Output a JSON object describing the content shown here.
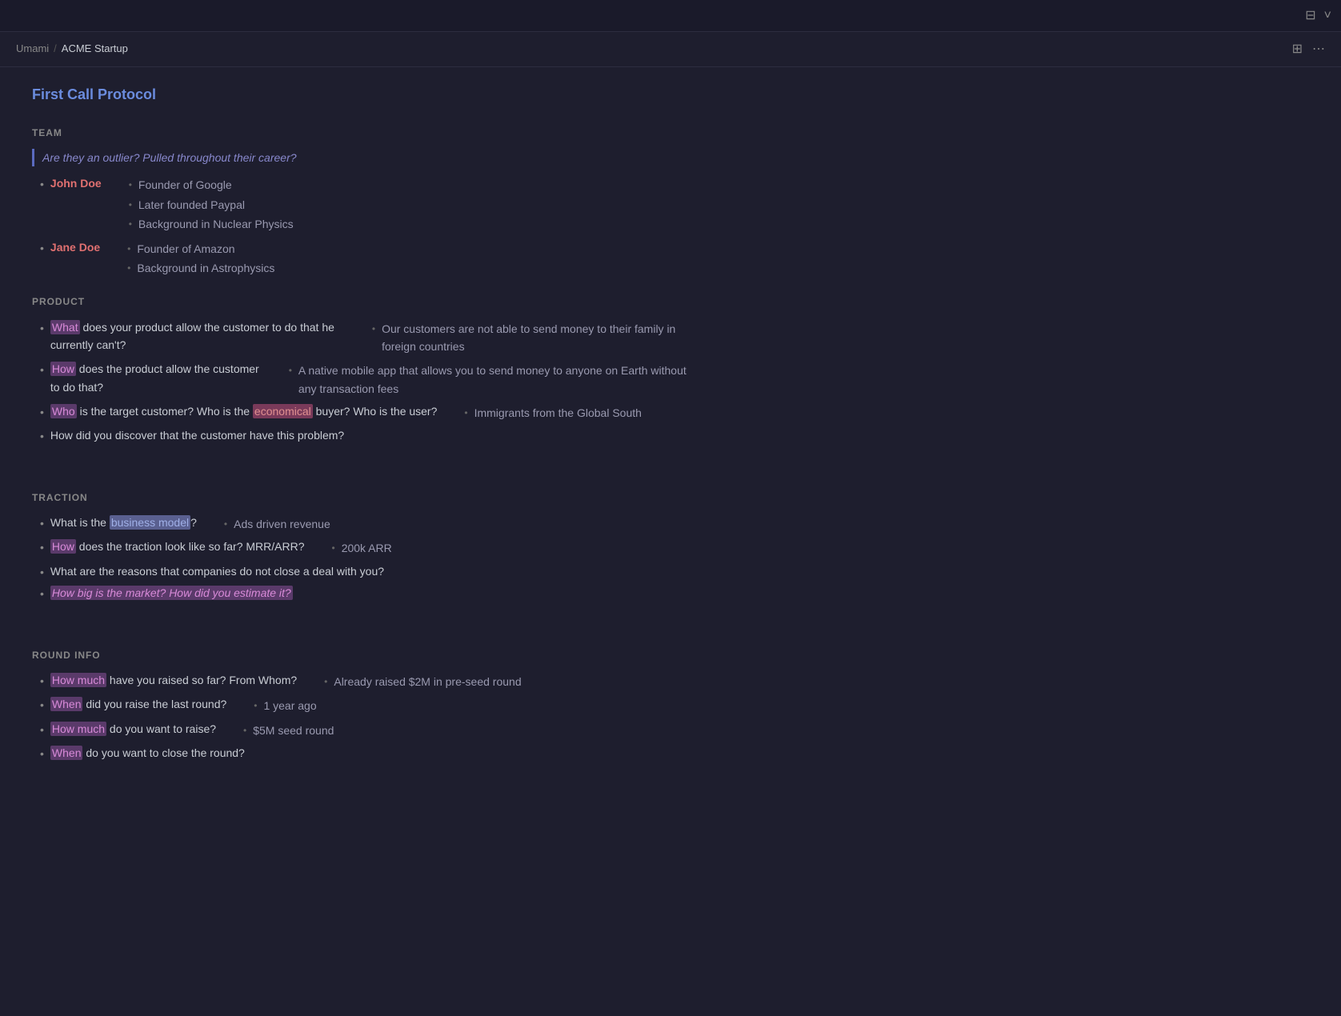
{
  "topbar": {
    "icon_collapse": "⊟",
    "icon_chevron": "˅"
  },
  "breadcrumb": {
    "root": "Umami",
    "separator": "/",
    "current": "ACME Startup"
  },
  "breadcrumb_actions": {
    "layout_icon": "⊞",
    "more_icon": "⋯"
  },
  "page": {
    "title": "First Call Protocol"
  },
  "sections": {
    "team": {
      "header": "TEAM",
      "callout": "Are they an outlier? Pulled throughout their career?",
      "members": [
        {
          "name": "John Doe",
          "items": [
            "Founder of Google",
            "Later founded Paypal",
            "Background in Nuclear Physics"
          ]
        },
        {
          "name": "Jane Doe",
          "items": [
            "Founder of Amazon",
            "Background in Astrophysics"
          ]
        }
      ]
    },
    "product": {
      "header": "PRODUCT",
      "questions": [
        {
          "prefix": "What",
          "text": " does your product allow the customer to do that he currently can't?",
          "answer": "Our customers are not able to send money to their family in foreign countries"
        },
        {
          "prefix": "How",
          "text": " does the product allow the customer to do that?",
          "answer": "A native mobile app that allows you to send money to anyone on Earth without any transaction fees"
        },
        {
          "who_prefix": "Who",
          "who_text": " is the target customer? Who is the ",
          "economical": "economical",
          "who_suffix": " buyer? Who is the user?",
          "answer": "Immigrants from the Global South"
        },
        {
          "standalone": "How did you discover that the customer have this problem?"
        }
      ]
    },
    "traction": {
      "header": "TRACTION",
      "questions": [
        {
          "prefix": "What is the ",
          "highlight": "business model",
          "suffix": "?",
          "answer": "Ads driven revenue"
        },
        {
          "prefix": "How",
          "text": " does the traction look like so far? MRR/ARR?",
          "answer": "200k ARR"
        },
        {
          "standalone": "What are the reasons that companies do not close a deal with you?"
        },
        {
          "italic_highlight": "How big is the market? How did you estimate it?"
        }
      ]
    },
    "round_info": {
      "header": "ROUND INFO",
      "questions": [
        {
          "prefix": "How much",
          "text": " have you raised so far? From Whom?",
          "answer": "Already raised $2M in pre-seed round"
        },
        {
          "prefix": "When",
          "text": " did you raise the last round?",
          "answer": "1 year ago"
        },
        {
          "prefix": "How much",
          "text": " do you want to raise?",
          "answer": "$5M seed round"
        },
        {
          "prefix": "When",
          "text": " do you want to close the round?"
        }
      ]
    }
  }
}
